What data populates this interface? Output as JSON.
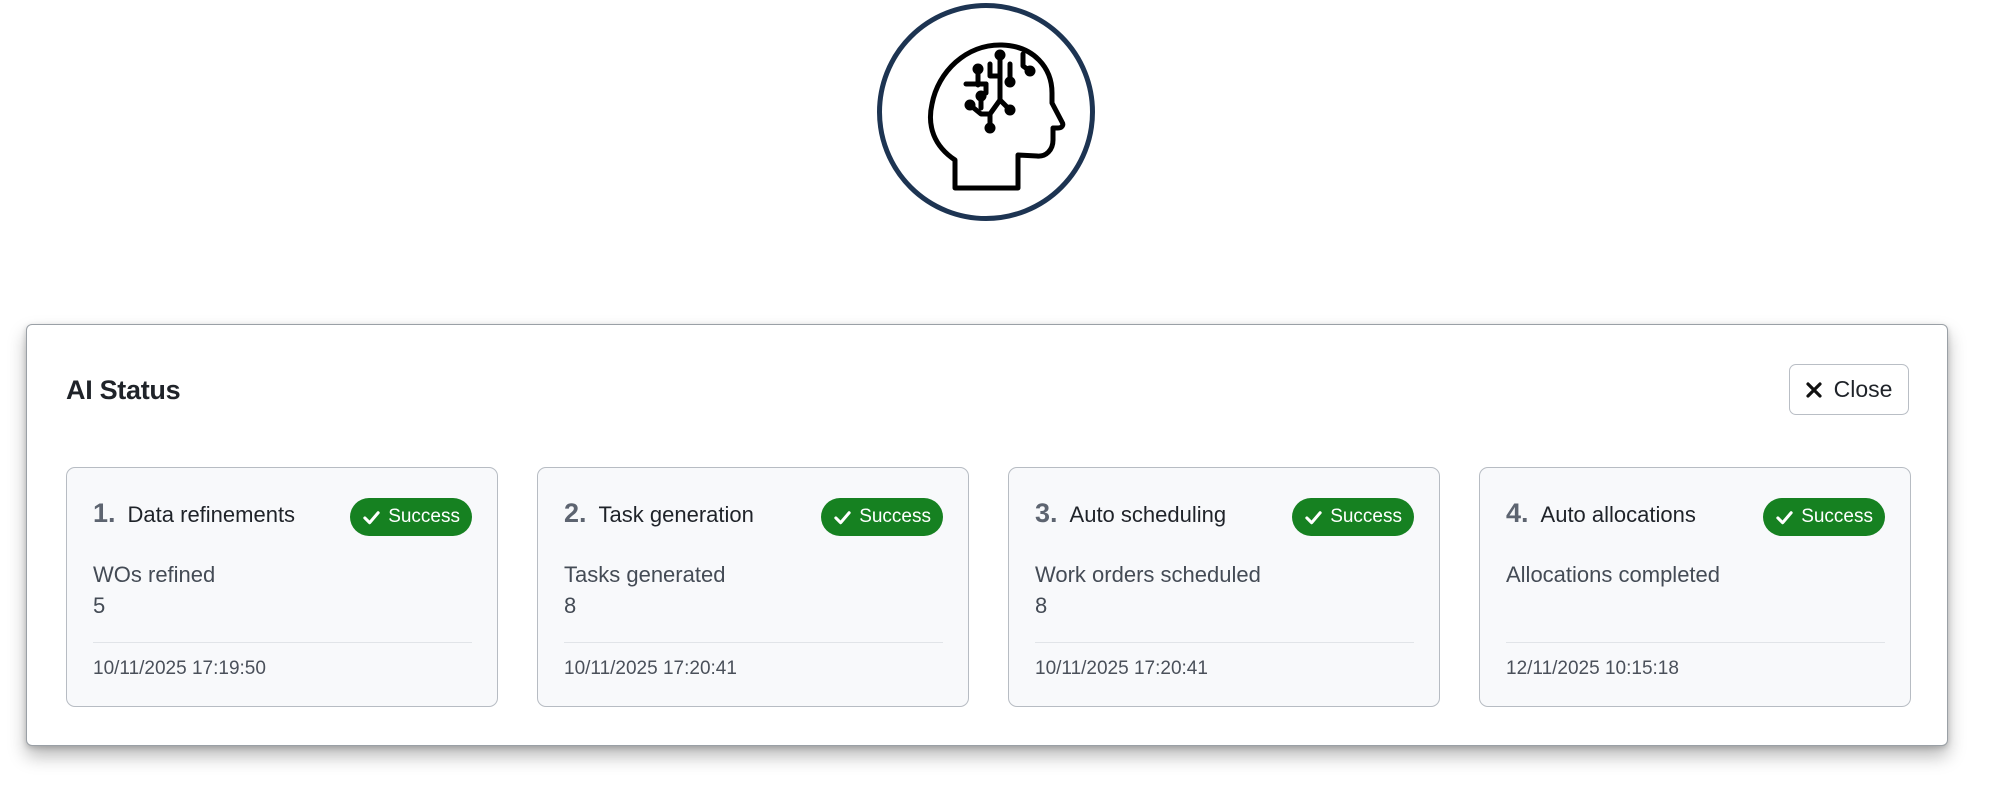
{
  "logo": {
    "icon": "ai-brain-head-icon",
    "ring_color": "#1d3452"
  },
  "modal": {
    "title": "AI Status",
    "close_label": "Close"
  },
  "status_color": "#168121",
  "steps": [
    {
      "number": "1.",
      "title": "Data refinements",
      "status": "Success",
      "metric_label": "WOs refined",
      "metric_value": "5",
      "timestamp": "10/11/2025 17:19:50"
    },
    {
      "number": "2.",
      "title": "Task generation",
      "status": "Success",
      "metric_label": "Tasks generated",
      "metric_value": "8",
      "timestamp": "10/11/2025 17:20:41"
    },
    {
      "number": "3.",
      "title": "Auto scheduling",
      "status": "Success",
      "metric_label": "Work orders scheduled",
      "metric_value": "8",
      "timestamp": "10/11/2025 17:20:41"
    },
    {
      "number": "4.",
      "title": "Auto allocations",
      "status": "Success",
      "metric_label": "Allocations completed",
      "metric_value": "",
      "timestamp": "12/11/2025 10:15:18"
    }
  ]
}
